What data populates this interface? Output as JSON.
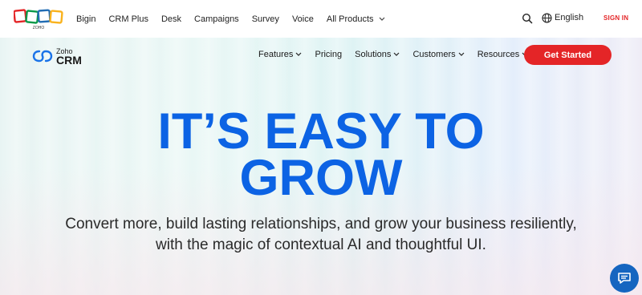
{
  "topbar": {
    "logo_alt": "ZOHO",
    "links": [
      "Bigin",
      "CRM Plus",
      "Desk",
      "Campaigns",
      "Survey",
      "Voice",
      "All Products"
    ],
    "language": "English",
    "signin": "SIGN IN",
    "icons": [
      "search-icon",
      "globe-icon",
      "chevron-down-icon"
    ]
  },
  "hero": {
    "brand_small": "Zoho",
    "brand_large": "CRM",
    "nav": [
      "Features",
      "Pricing",
      "Solutions",
      "Customers",
      "Resources"
    ],
    "cta": "Get Started",
    "headline_line1": "IT’S EASY TO",
    "headline_line2": "GROW",
    "subtitle_line1": "Convert more, build lasting relationships, and grow your business resiliently,",
    "subtitle_line2": "with the magic of contextual AI and thoughtful UI."
  },
  "colors": {
    "accent": "#e42527",
    "headline": "#0c63e4",
    "chat": "#1565c0"
  }
}
